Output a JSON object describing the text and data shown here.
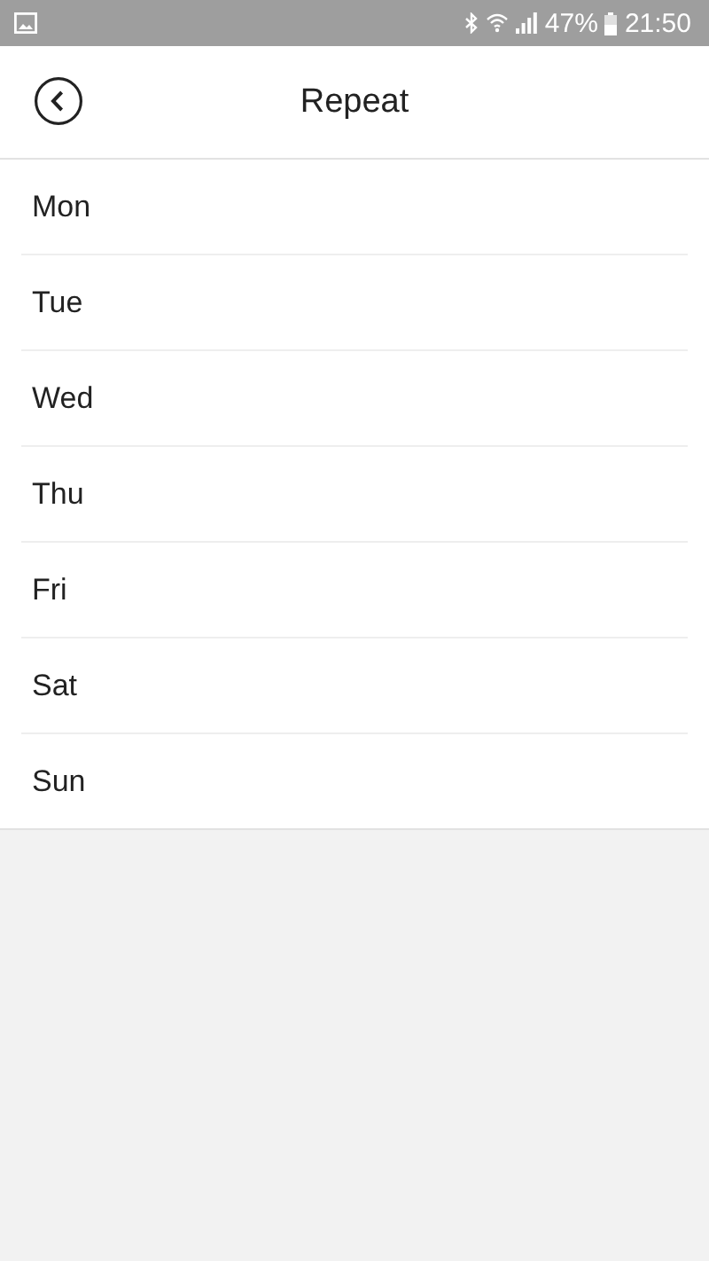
{
  "status_bar": {
    "battery": "47%",
    "time": "21:50"
  },
  "header": {
    "title": "Repeat"
  },
  "days": [
    {
      "label": "Mon"
    },
    {
      "label": "Tue"
    },
    {
      "label": "Wed"
    },
    {
      "label": "Thu"
    },
    {
      "label": "Fri"
    },
    {
      "label": "Sat"
    },
    {
      "label": "Sun"
    }
  ]
}
